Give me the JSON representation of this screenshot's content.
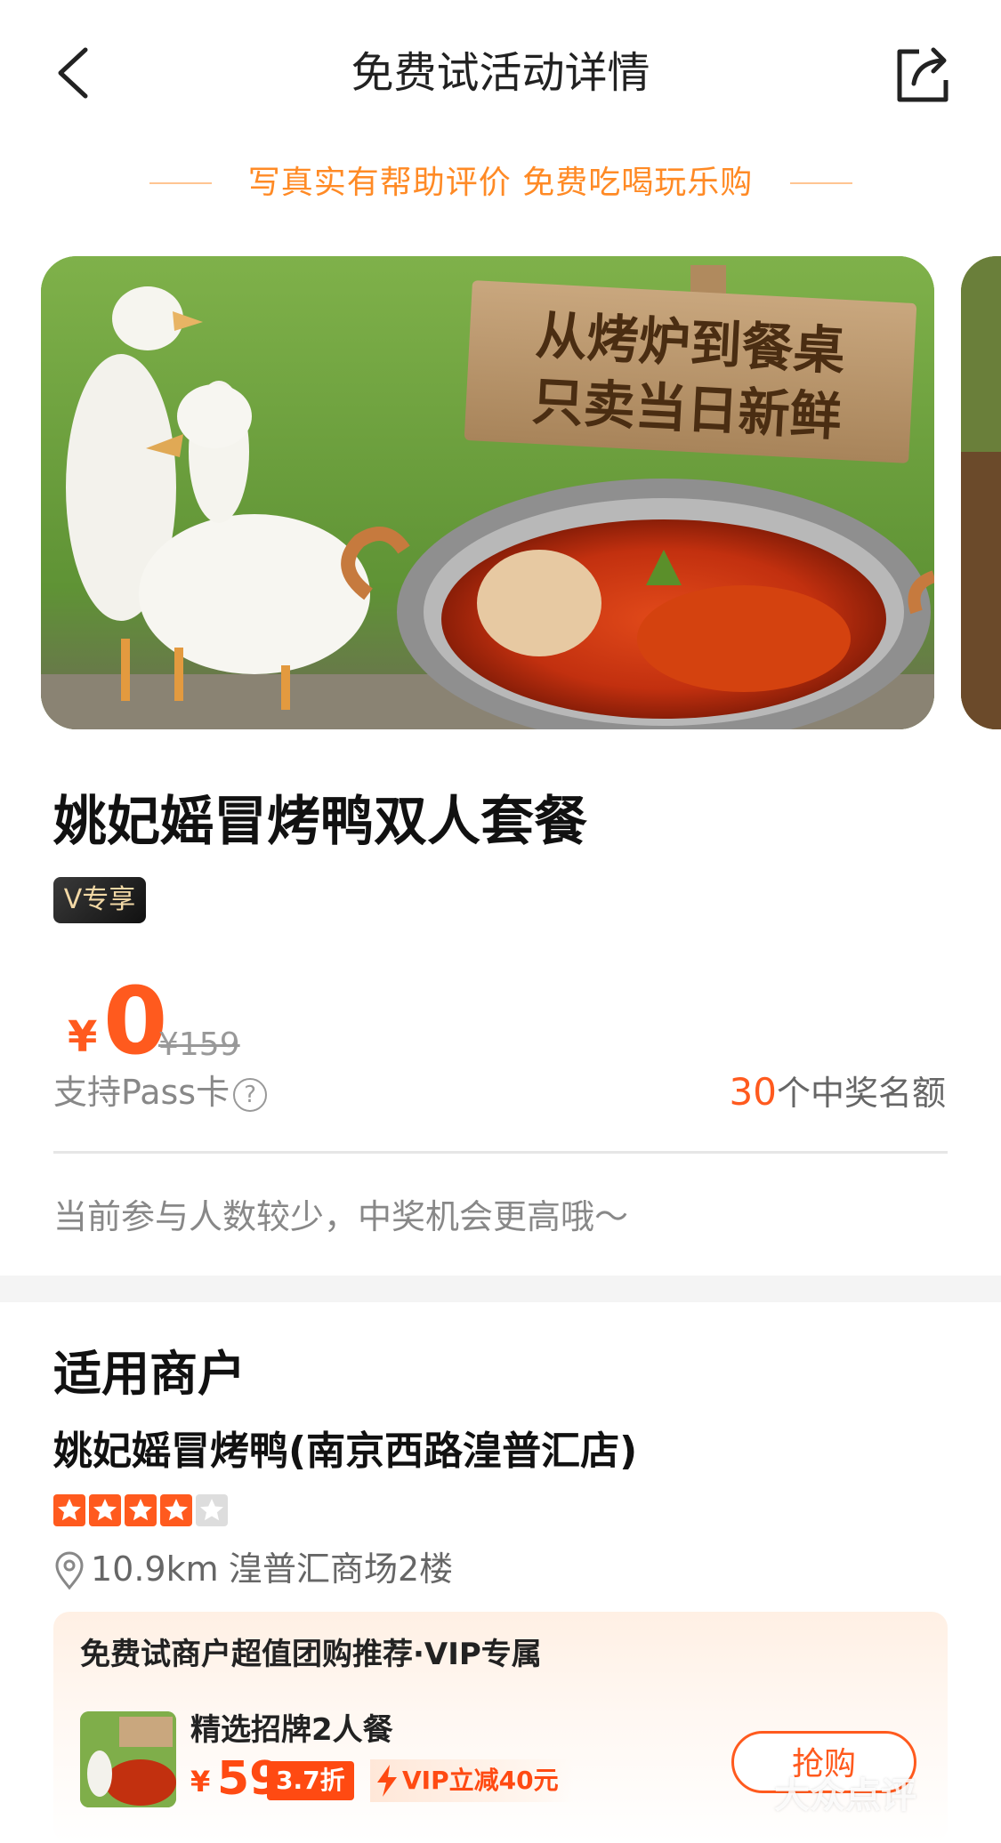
{
  "header": {
    "title": "免费试活动详情",
    "back_icon": "chevron-left-icon",
    "share_icon": "share-icon"
  },
  "slogan": "写真实有帮助评价 免费吃喝玩乐购",
  "hero": {
    "sign_line1": "从烤炉到餐桌",
    "sign_line2": "只卖当日新鲜"
  },
  "product": {
    "title": "姚妃媱冒烤鸭双人套餐",
    "tag": "V专享",
    "price_symbol": "¥",
    "price": "0",
    "original_price": "¥159",
    "pass_label": "支持Pass卡",
    "help_icon": "?",
    "quota_number": "30",
    "quota_text": "个中奖名额",
    "tip": "当前参与人数较少，中奖机会更高哦～"
  },
  "merchant": {
    "heading": "适用商户",
    "name": "姚妃媱冒烤鸭(南京西路湟普汇店)",
    "rating": 4,
    "rating_max": 5,
    "distance": "10.9km",
    "address": "湟普汇商场2楼"
  },
  "recommendation": {
    "title": "免费试商户超值团购推荐·VIP专属",
    "deal_name": "精选招牌2人餐",
    "price_symbol": "¥",
    "price": "59",
    "discount": "3.7折",
    "vip_promo": "VIP立减40元",
    "buy_label": "抢购"
  },
  "watermark": "大众点评",
  "colors": {
    "accent": "#ff5a1e",
    "slogan": "#ff8a25"
  }
}
